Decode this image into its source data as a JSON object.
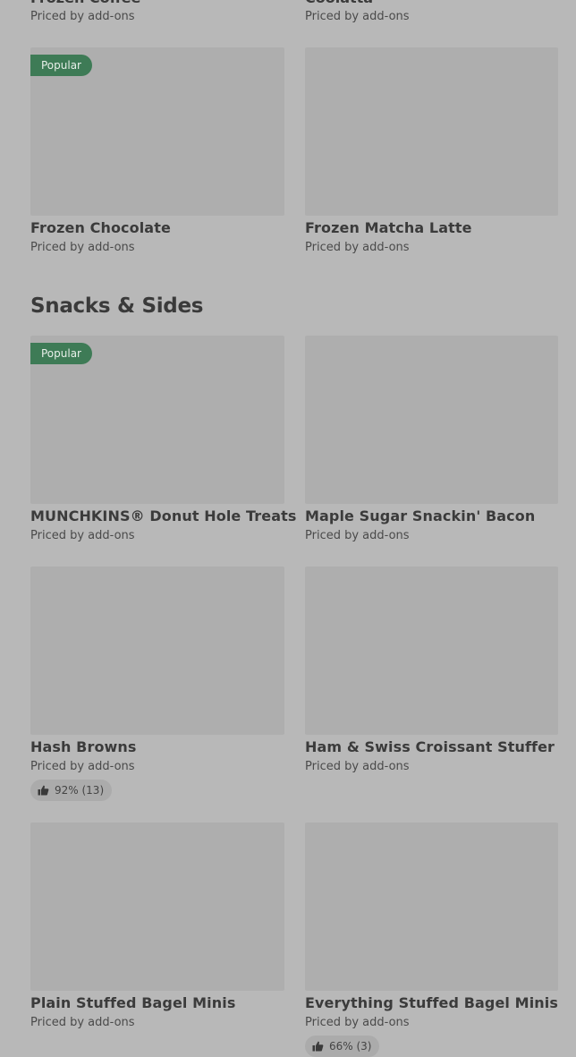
{
  "top_partial": {
    "left": {
      "name": "Frozen Coffee",
      "price": "Priced by add-ons"
    },
    "right": {
      "name": "Coolatta",
      "price": "Priced by add-ons"
    }
  },
  "rows": [
    {
      "left": {
        "badge": "Popular",
        "name": "Frozen Chocolate",
        "price": "Priced by add-ons"
      },
      "right": {
        "name": "Frozen Matcha Latte",
        "price": "Priced by add-ons"
      }
    }
  ],
  "section": {
    "title": "Snacks & Sides",
    "items": [
      {
        "badge": "Popular",
        "name": "MUNCHKINS® Donut Hole Treats",
        "price": "Priced by add-ons"
      },
      {
        "name": "Maple Sugar Snackin' Bacon",
        "price": "Priced by add-ons"
      },
      {
        "name": "Hash Browns",
        "price": "Priced by add-ons",
        "rating": "92% (13)"
      },
      {
        "name": "Ham & Swiss Croissant Stuffer",
        "price": "Priced by add-ons"
      },
      {
        "name": "Plain Stuffed Bagel Minis",
        "price": "Priced by add-ons"
      },
      {
        "name": "Everything Stuffed Bagel Minis",
        "price": "Priced by add-ons",
        "rating": "66% (3)"
      }
    ]
  },
  "icons": {
    "rating": "thumbs-up-icon"
  }
}
